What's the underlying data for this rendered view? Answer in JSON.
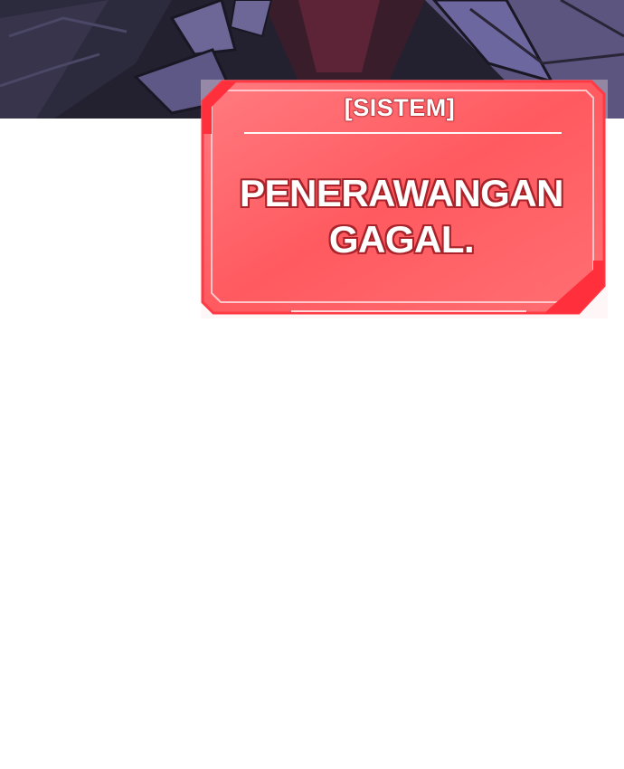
{
  "system_window": {
    "title": "[SISTEM]",
    "message_line1": "PENERAWANGAN",
    "message_line2": "GAGAL."
  },
  "colors": {
    "panel_fill": "#ff5a5f",
    "panel_border": "#ffc2c4",
    "text_outline": "#a8232a",
    "art_dark": "#2a2536",
    "art_purple": "#5b5580"
  },
  "icons": {
    "art_strip": "character-clothing-illustration"
  }
}
